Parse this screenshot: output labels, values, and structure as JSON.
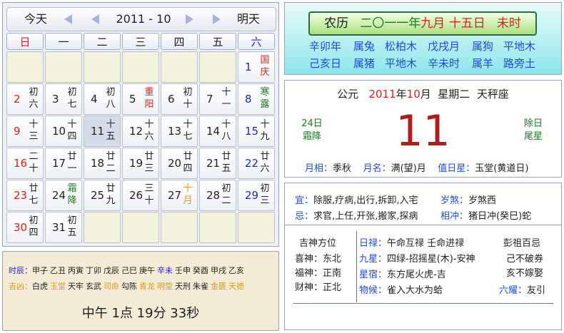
{
  "nav": {
    "today": "今天",
    "month_label": "2011 - 10",
    "tomorrow": "明天"
  },
  "weekdays": [
    "日",
    "一",
    "二",
    "三",
    "四",
    "五",
    "六"
  ],
  "calendar": [
    {
      "d": "",
      "l": ""
    },
    {
      "d": "",
      "l": ""
    },
    {
      "d": "",
      "l": ""
    },
    {
      "d": "",
      "l": ""
    },
    {
      "d": "",
      "l": ""
    },
    {
      "d": "",
      "l": ""
    },
    {
      "d": "1",
      "l": "国庆",
      "dc": "blue",
      "lc": "red"
    },
    {
      "d": "2",
      "l": "初六",
      "dc": "red"
    },
    {
      "d": "3",
      "l": "初七"
    },
    {
      "d": "4",
      "l": "初八"
    },
    {
      "d": "5",
      "l": "重阳",
      "lc": "red"
    },
    {
      "d": "6",
      "l": "初十"
    },
    {
      "d": "7",
      "l": "十一"
    },
    {
      "d": "8",
      "l": "寒露",
      "dc": "blue",
      "lc": "green"
    },
    {
      "d": "9",
      "l": "十三",
      "dc": "red"
    },
    {
      "d": "10",
      "l": "十四"
    },
    {
      "d": "11",
      "l": "十五",
      "today": true
    },
    {
      "d": "12",
      "l": "十六"
    },
    {
      "d": "13",
      "l": "十七"
    },
    {
      "d": "14",
      "l": "十八"
    },
    {
      "d": "15",
      "l": "十九",
      "dc": "blue"
    },
    {
      "d": "16",
      "l": "二十",
      "dc": "red"
    },
    {
      "d": "17",
      "l": "廿一"
    },
    {
      "d": "18",
      "l": "廿二"
    },
    {
      "d": "19",
      "l": "廿三"
    },
    {
      "d": "20",
      "l": "廿四"
    },
    {
      "d": "21",
      "l": "廿五"
    },
    {
      "d": "22",
      "l": "廿六",
      "dc": "blue"
    },
    {
      "d": "23",
      "l": "廿七",
      "dc": "red"
    },
    {
      "d": "24",
      "l": "霜降",
      "lc": "green"
    },
    {
      "d": "25",
      "l": "廿九"
    },
    {
      "d": "26",
      "l": "三十"
    },
    {
      "d": "27",
      "l": "十月",
      "lc": "orange"
    },
    {
      "d": "28",
      "l": "初二"
    },
    {
      "d": "29",
      "l": "初三",
      "dc": "blue"
    },
    {
      "d": "30",
      "l": "初四",
      "dc": "red"
    },
    {
      "d": "31",
      "l": "初五"
    },
    {
      "d": "",
      "l": ""
    },
    {
      "d": "",
      "l": ""
    },
    {
      "d": "",
      "l": ""
    },
    {
      "d": "",
      "l": ""
    },
    {
      "d": "",
      "l": ""
    }
  ],
  "hours": {
    "label_shichen": "时辰：",
    "shichen": [
      "甲子",
      "乙丑",
      "丙寅",
      "丁卯",
      "戊辰",
      "己巳",
      "庚午",
      "辛未",
      "壬申",
      "癸酉",
      "甲戌",
      "乙亥"
    ],
    "label_jixiong": "吉凶：",
    "jixiong": [
      "白虎",
      "玉堂",
      "天牢",
      "玄武",
      "司命",
      "勾陈",
      "青龙",
      "明堂",
      "天刑",
      "朱雀",
      "金匮",
      "天德"
    ],
    "clock": "中午 1点 19分 33秒"
  },
  "lunar": {
    "p1": "农历",
    "p2": "二〇一一年",
    "p3": "九月",
    "p4": "十五日",
    "p5": "未时",
    "row1": [
      "辛卯年",
      "属兔",
      "松柏木",
      "戊戌月",
      "属狗",
      "平地木"
    ],
    "row2": [
      "己亥日",
      "属猪",
      "平地木",
      "辛未时",
      "属羊",
      "路旁土"
    ]
  },
  "date": {
    "gl1": "公元",
    "year": "2011",
    "gl2": "年",
    "month": "10",
    "gl3": "月  星期二  天秤座",
    "big": "11",
    "left1": "24日",
    "left2": "霜降",
    "right1": "除日",
    "right2": "尾星",
    "yx_label": "月相：",
    "yx": "季秋",
    "ym_label": "月名：",
    "ym": "满(望)月",
    "zr_label": "值日星：",
    "zr": "玉堂(黄道日)"
  },
  "yiji": {
    "yi_label": "宜：",
    "yi": "除服,疗病,出行,拆卸,入宅",
    "ji_label": "忌：",
    "ji": "求官,上任,开张,搬家,探病",
    "sui_label": "岁煞：",
    "sui": "岁煞西",
    "xc_label": "相冲：",
    "xc": "猪日冲(癸巳)蛇"
  },
  "dirs": {
    "head": "吉神方位",
    "xi": "喜神：东北",
    "fu": "福神：正南",
    "cai": "财神：正北",
    "rl_label": "日禄：",
    "rl": "午命互禄 壬命进禄",
    "jx_label": "九星：",
    "jx": "四绿-招摇星(木)-安神",
    "xs_label": "星宿：",
    "xs": "东方尾火虎-吉",
    "wh_label": "物候：",
    "wh": "雀入大水为蛤",
    "pz_head": "彭祖百忌",
    "pz1": "己不破券",
    "pz2": "亥不嫁娶",
    "ly_label": "六耀：",
    "ly": "友引"
  },
  "colors": {
    "red": "#d9221b",
    "blue": "#1a2ac2",
    "green": "#1d7a22",
    "orange": "#e19a14"
  }
}
